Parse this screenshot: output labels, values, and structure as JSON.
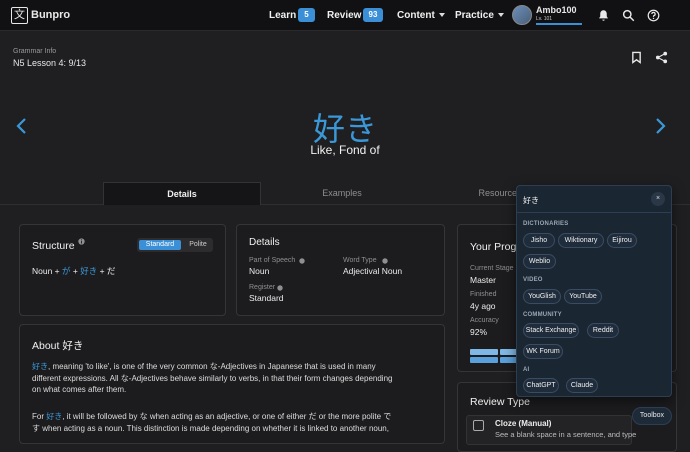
{
  "nav": {
    "brand": "Bunpro",
    "logo_glyph": "文",
    "learn": "Learn",
    "learn_count": "5",
    "review": "Review",
    "review_count": "93",
    "content": "Content",
    "practice": "Practice",
    "username": "Ambo100",
    "level": "Lv. 101"
  },
  "header": {
    "section": "Grammar Info",
    "lesson": "N5 Lesson 4: 9/13"
  },
  "grammar": {
    "point": "好き",
    "meaning": "Like, Fond of"
  },
  "tabs": [
    "Details",
    "Examples",
    "Resources"
  ],
  "structure": {
    "title": "Structure",
    "toggle_on": "Standard",
    "toggle_off": "Polite",
    "formula_a": "Noun + ",
    "formula_b": "が",
    "formula_c": " + ",
    "formula_d": "好き",
    "formula_e": " + だ"
  },
  "details": {
    "title": "Details",
    "pos_label": "Part of Speech",
    "pos_value": "Noun",
    "word_type_label": "Word Type",
    "word_type_value": "Adjectival Noun",
    "register_label": "Register",
    "register_value": "Standard"
  },
  "progress": {
    "title": "Your Prog",
    "stage_label": "Current Stage",
    "stage_value": "Master",
    "finished_label": "Finished",
    "finished_value": "4y ago",
    "accuracy_label": "Accuracy",
    "accuracy_value": "92%"
  },
  "about": {
    "title": "About 好き",
    "p1_l1a": "好き",
    "p1_l1b": ", meaning 'to like', is one of the very common な-Adjectives in Japanese that is used in many",
    "p1_l2": "different expressions. All な-Adjectives behave similarly to verbs, in that their form changes depending",
    "p1_l3": "on what comes after them.",
    "p2_l1a": "For ",
    "p2_l1b": "好き",
    "p2_l1c": ", it will be followed by な when acting as an adjective, or one of either だ or the more polite で",
    "p2_l2": "す when acting as a noun. This distinction is made depending on whether it is linked to another noun,"
  },
  "review_type": {
    "title": "Review Type",
    "option": "Cloze (Manual)",
    "desc": "See a blank space in a sentence, and type"
  },
  "popup": {
    "title": "好き",
    "close": "×",
    "dictionaries": "DICTIONARIES",
    "dict_items": [
      "Jisho",
      "Wiktionary",
      "Eijirou",
      "Weblio"
    ],
    "video": "VIDEO",
    "video_items": [
      "YouGlish",
      "YouTube"
    ],
    "community": "COMMUNITY",
    "community_items": [
      "Stack Exchange",
      "Reddit",
      "WK Forum"
    ],
    "ai": "AI",
    "ai_items": [
      "ChatGPT",
      "Claude"
    ]
  },
  "toolbox": "Toolbox",
  "colors": {
    "accent": "#3b8fd6",
    "bg": "#1f1f21",
    "nav": "#111113"
  }
}
